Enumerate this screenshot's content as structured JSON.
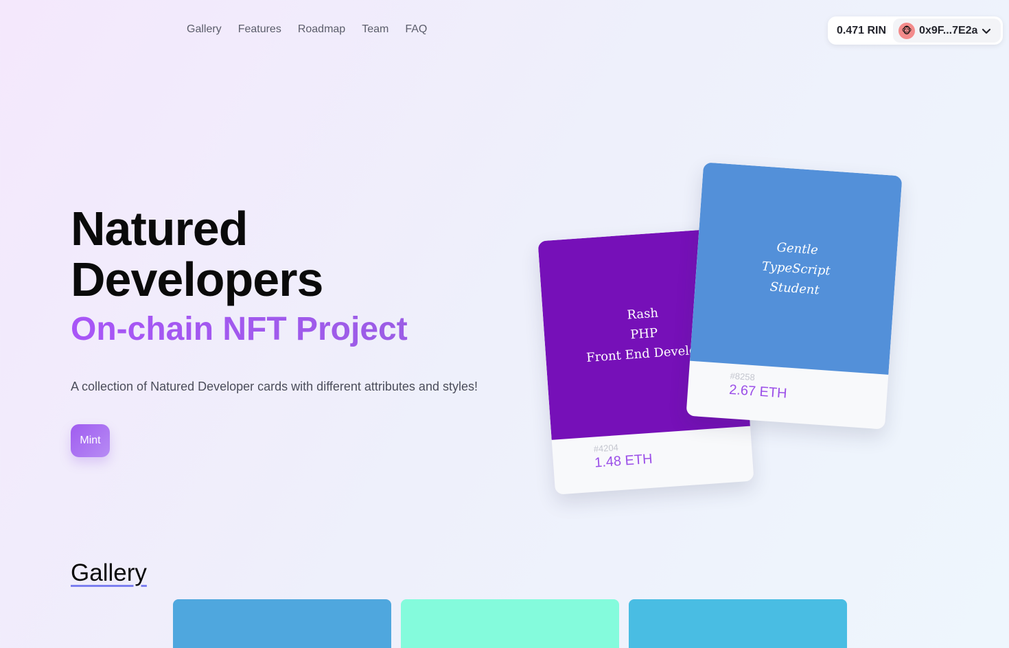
{
  "nav": {
    "items": [
      "Gallery",
      "Features",
      "Roadmap",
      "Team",
      "FAQ"
    ]
  },
  "wallet": {
    "balance": "0.471 RIN",
    "address": "0x9F...7E2a",
    "avatar_icon": "monkey-face-icon"
  },
  "hero": {
    "title_line1": "Natured",
    "title_line2": "Developers",
    "subtitle": "On-chain NFT Project",
    "description": "A collection of Natured Developer cards with different attributes and styles!",
    "mint_label": "Mint"
  },
  "cards": [
    {
      "lines": "Rash\nPHP\nFront End Develop",
      "token": "#4204",
      "price": "1.48 ETH",
      "color": "#7610b8"
    },
    {
      "lines": "Gentle\nTypeScript\nStudent",
      "token": "#8258",
      "price": "2.67 ETH",
      "color": "#5390d9"
    }
  ],
  "gallery": {
    "title": "Gallery",
    "item_colors": [
      "#4fa7de",
      "#84fbdc",
      "#49bde3"
    ]
  }
}
